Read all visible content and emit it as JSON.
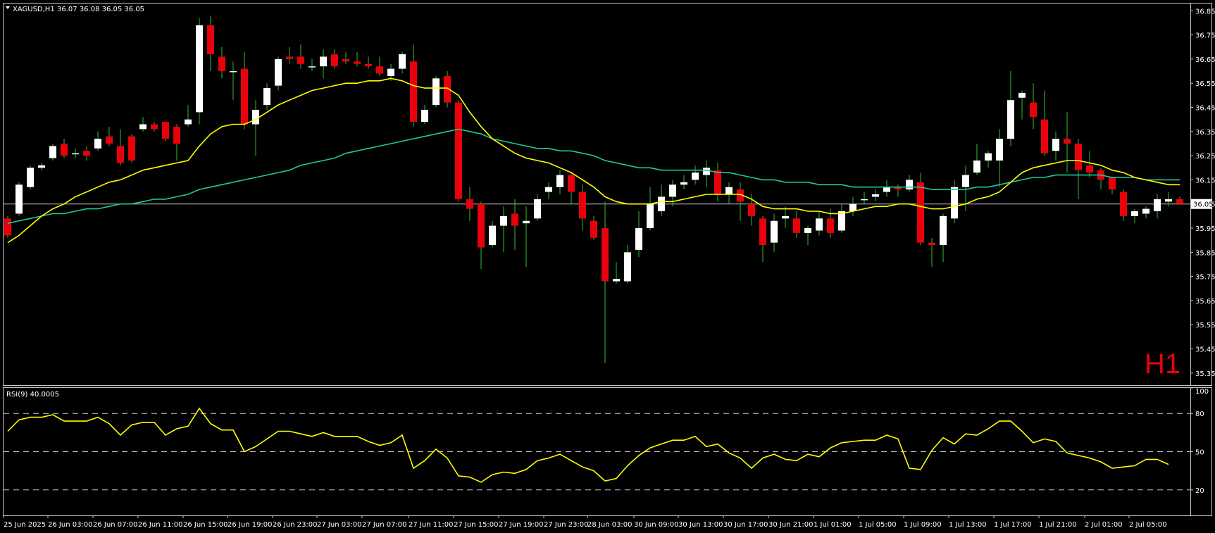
{
  "header": {
    "symbol": "XAGUSD,H1",
    "ohlc": "36.07 36.08 36.05 36.05",
    "timeframe_watermark": "H1"
  },
  "rsi_panel": {
    "label": "RSI(9) 40.0005"
  },
  "colors": {
    "background": "#000000",
    "frame": "#c8c8c8",
    "bull_candle": "#ffffff",
    "bear_candle": "#e8000b",
    "wick": "#2ec02e",
    "ma_fast": "#ffff00",
    "ma_slow": "#20c997",
    "rsi_line": "#ffff00",
    "price_line": "#c8c8c8",
    "watermark": "#e8000b"
  },
  "chart_data": [
    {
      "type": "candlestick",
      "title": "XAGUSD,H1",
      "ylim": [
        35.3,
        36.88
      ],
      "y_ticks": [
        "36.85",
        "36.75",
        "36.65",
        "36.55",
        "36.45",
        "36.35",
        "36.25",
        "36.15",
        "36.05",
        "35.95",
        "35.85",
        "35.75",
        "35.65",
        "35.55",
        "35.45",
        "35.35"
      ],
      "current_price": 36.05,
      "current_price_label": "36.05",
      "x_ticks": [
        "25 Jun 2025",
        "26 Jun 03:00",
        "26 Jun 07:00",
        "26 Jun 11:00",
        "26 Jun 15:00",
        "26 Jun 19:00",
        "26 Jun 23:00",
        "27 Jun 03:00",
        "27 Jun 07:00",
        "27 Jun 11:00",
        "27 Jun 15:00",
        "27 Jun 19:00",
        "27 Jun 23:00",
        "28 Jun 03:00",
        "30 Jun 09:00",
        "30 Jun 13:00",
        "30 Jun 17:00",
        "30 Jun 21:00",
        "1 Jul 01:00",
        "1 Jul 05:00",
        "1 Jul 09:00",
        "1 Jul 13:00",
        "1 Jul 17:00",
        "1 Jul 21:00",
        "2 Jul 01:00",
        "2 Jul 05:00"
      ],
      "candles": [
        [
          35.99,
          35.92,
          36.0,
          35.91
        ],
        [
          36.01,
          36.13,
          36.14,
          36.0
        ],
        [
          36.12,
          36.2,
          36.21,
          36.11
        ],
        [
          36.2,
          36.21,
          36.22,
          36.19
        ],
        [
          36.24,
          36.29,
          36.3,
          36.23
        ],
        [
          36.3,
          36.25,
          36.32,
          36.24
        ],
        [
          36.26,
          36.26,
          36.28,
          36.24
        ],
        [
          36.27,
          36.25,
          36.29,
          36.23
        ],
        [
          36.28,
          36.32,
          36.35,
          36.27
        ],
        [
          36.33,
          36.3,
          36.37,
          36.29
        ],
        [
          36.29,
          36.22,
          36.36,
          36.21
        ],
        [
          36.33,
          36.23,
          36.34,
          36.22
        ],
        [
          36.36,
          36.38,
          36.41,
          36.35
        ],
        [
          36.38,
          36.36,
          36.39,
          36.35
        ],
        [
          36.39,
          36.32,
          36.39,
          36.31
        ],
        [
          36.37,
          36.3,
          36.38,
          36.23
        ],
        [
          36.38,
          36.4,
          36.46,
          36.37
        ],
        [
          36.43,
          36.79,
          36.82,
          36.38
        ],
        [
          36.79,
          36.67,
          36.83,
          36.6
        ],
        [
          36.66,
          36.6,
          36.7,
          36.57
        ],
        [
          36.6,
          36.6,
          36.64,
          36.48
        ],
        [
          36.61,
          36.38,
          36.68,
          36.36
        ],
        [
          36.38,
          36.44,
          36.48,
          36.25
        ],
        [
          36.46,
          36.53,
          36.55,
          36.44
        ],
        [
          36.54,
          36.65,
          36.66,
          36.52
        ],
        [
          36.66,
          36.65,
          36.7,
          36.63
        ],
        [
          36.66,
          36.63,
          36.71,
          36.61
        ],
        [
          36.62,
          36.62,
          36.65,
          36.6
        ],
        [
          36.62,
          36.66,
          36.69,
          36.57
        ],
        [
          36.67,
          36.62,
          36.69,
          36.61
        ],
        [
          36.65,
          36.64,
          36.68,
          36.63
        ],
        [
          36.64,
          36.63,
          36.68,
          36.62
        ],
        [
          36.63,
          36.62,
          36.66,
          36.61
        ],
        [
          36.62,
          36.59,
          36.66,
          36.58
        ],
        [
          36.58,
          36.61,
          36.63,
          36.56
        ],
        [
          36.61,
          36.67,
          36.68,
          36.59
        ],
        [
          36.64,
          36.39,
          36.71,
          36.37
        ],
        [
          36.39,
          36.44,
          36.46,
          36.38
        ],
        [
          36.46,
          36.57,
          36.58,
          36.45
        ],
        [
          36.58,
          36.47,
          36.6,
          36.45
        ],
        [
          36.47,
          36.07,
          36.48,
          36.06
        ],
        [
          36.07,
          36.03,
          36.12,
          35.98
        ],
        [
          36.05,
          35.87,
          36.06,
          35.78
        ],
        [
          35.88,
          35.96,
          35.98,
          35.87
        ],
        [
          35.96,
          36.0,
          36.04,
          35.85
        ],
        [
          36.01,
          35.96,
          36.07,
          35.86
        ],
        [
          35.97,
          35.98,
          36.04,
          35.79
        ],
        [
          35.99,
          36.07,
          36.09,
          35.98
        ],
        [
          36.1,
          36.12,
          36.14,
          36.07
        ],
        [
          36.12,
          36.17,
          36.19,
          36.09
        ],
        [
          36.17,
          36.1,
          36.18,
          36.05
        ],
        [
          36.1,
          35.99,
          36.13,
          35.94
        ],
        [
          35.98,
          35.91,
          36.0,
          35.9
        ],
        [
          35.95,
          35.73,
          36.06,
          35.39
        ],
        [
          35.73,
          35.74,
          35.81,
          35.72
        ],
        [
          35.73,
          35.85,
          35.88,
          35.72
        ],
        [
          35.86,
          35.95,
          36.02,
          35.83
        ],
        [
          35.95,
          36.05,
          36.12,
          35.94
        ],
        [
          36.02,
          36.08,
          36.13,
          36.0
        ],
        [
          36.08,
          36.13,
          36.15,
          36.04
        ],
        [
          36.13,
          36.14,
          36.17,
          36.11
        ],
        [
          36.15,
          36.18,
          36.21,
          36.13
        ],
        [
          36.17,
          36.2,
          36.23,
          36.12
        ],
        [
          36.19,
          36.09,
          36.22,
          36.06
        ],
        [
          36.09,
          36.12,
          36.14,
          36.05
        ],
        [
          36.11,
          36.06,
          36.14,
          35.98
        ],
        [
          36.05,
          36.0,
          36.09,
          35.96
        ],
        [
          35.99,
          35.88,
          36.0,
          35.81
        ],
        [
          35.89,
          35.98,
          36.01,
          35.85
        ],
        [
          35.99,
          36.0,
          36.04,
          35.95
        ],
        [
          35.99,
          35.93,
          36.02,
          35.91
        ],
        [
          35.93,
          35.95,
          35.96,
          35.88
        ],
        [
          35.94,
          35.99,
          36.02,
          35.92
        ],
        [
          35.99,
          35.93,
          36.03,
          35.91
        ],
        [
          35.94,
          36.02,
          36.05,
          35.93
        ],
        [
          36.02,
          36.05,
          36.08,
          36.0
        ],
        [
          36.07,
          36.07,
          36.1,
          36.05
        ],
        [
          36.08,
          36.09,
          36.11,
          36.06
        ],
        [
          36.1,
          36.12,
          36.15,
          36.08
        ],
        [
          36.12,
          36.11,
          36.13,
          36.08
        ],
        [
          36.11,
          36.15,
          36.17,
          36.1
        ],
        [
          36.14,
          35.89,
          36.18,
          35.88
        ],
        [
          35.89,
          35.88,
          35.91,
          35.79
        ],
        [
          35.88,
          36.0,
          36.01,
          35.81
        ],
        [
          35.99,
          36.12,
          36.15,
          35.97
        ],
        [
          36.12,
          36.17,
          36.21,
          36.02
        ],
        [
          36.18,
          36.23,
          36.3,
          36.17
        ],
        [
          36.23,
          36.26,
          36.27,
          36.2
        ],
        [
          36.23,
          36.32,
          36.36,
          36.12
        ],
        [
          36.32,
          36.48,
          36.6,
          36.29
        ],
        [
          36.49,
          36.51,
          36.52,
          36.4
        ],
        [
          36.47,
          36.41,
          36.55,
          36.36
        ],
        [
          36.4,
          36.26,
          36.52,
          36.25
        ],
        [
          36.27,
          36.32,
          36.35,
          36.23
        ],
        [
          36.32,
          36.3,
          36.43,
          36.18
        ],
        [
          36.3,
          36.19,
          36.32,
          36.07
        ],
        [
          36.21,
          36.18,
          36.27,
          36.16
        ],
        [
          36.19,
          36.15,
          36.2,
          36.11
        ],
        [
          36.16,
          36.11,
          36.16,
          36.09
        ],
        [
          36.1,
          36.0,
          36.11,
          35.98
        ],
        [
          36.0,
          36.02,
          36.03,
          35.97
        ],
        [
          36.01,
          36.03,
          36.04,
          35.99
        ],
        [
          36.02,
          36.07,
          36.09,
          35.99
        ],
        [
          36.06,
          36.07,
          36.1,
          36.04
        ],
        [
          36.07,
          36.05,
          36.08,
          36.05
        ]
      ],
      "ma_fast": [
        35.89,
        35.92,
        35.96,
        36.0,
        36.03,
        36.05,
        36.08,
        36.1,
        36.12,
        36.14,
        36.15,
        36.17,
        36.19,
        36.2,
        36.21,
        36.22,
        36.23,
        36.29,
        36.34,
        36.37,
        36.38,
        36.38,
        36.4,
        36.43,
        36.46,
        36.48,
        36.5,
        36.52,
        36.53,
        36.54,
        36.55,
        36.55,
        36.56,
        36.56,
        36.57,
        36.56,
        36.54,
        36.53,
        36.53,
        36.53,
        36.5,
        36.43,
        36.37,
        36.32,
        36.29,
        36.26,
        36.24,
        36.23,
        36.22,
        36.2,
        36.18,
        36.15,
        36.12,
        36.08,
        36.06,
        36.05,
        36.05,
        36.05,
        36.06,
        36.06,
        36.07,
        36.08,
        36.09,
        36.09,
        36.09,
        36.09,
        36.07,
        36.04,
        36.03,
        36.03,
        36.03,
        36.02,
        36.02,
        36.01,
        36.01,
        36.02,
        36.03,
        36.04,
        36.04,
        36.05,
        36.05,
        36.04,
        36.03,
        36.03,
        36.04,
        36.05,
        36.07,
        36.08,
        36.1,
        36.14,
        36.18,
        36.2,
        36.21,
        36.22,
        36.23,
        36.23,
        36.22,
        36.21,
        36.19,
        36.18,
        36.16,
        36.15,
        36.14,
        36.13,
        36.13
      ],
      "ma_slow": [
        35.97,
        35.98,
        35.99,
        36.0,
        36.01,
        36.01,
        36.02,
        36.03,
        36.03,
        36.04,
        36.05,
        36.05,
        36.06,
        36.07,
        36.07,
        36.08,
        36.09,
        36.11,
        36.12,
        36.13,
        36.14,
        36.15,
        36.16,
        36.17,
        36.18,
        36.19,
        36.21,
        36.22,
        36.23,
        36.24,
        36.26,
        36.27,
        36.28,
        36.29,
        36.3,
        36.31,
        36.32,
        36.33,
        36.34,
        36.35,
        36.36,
        36.35,
        36.34,
        36.32,
        36.31,
        36.3,
        36.29,
        36.28,
        36.28,
        36.27,
        36.27,
        36.26,
        36.25,
        36.23,
        36.22,
        36.21,
        36.2,
        36.2,
        36.19,
        36.19,
        36.19,
        36.19,
        36.19,
        36.18,
        36.18,
        36.17,
        36.16,
        36.15,
        36.15,
        36.14,
        36.14,
        36.14,
        36.13,
        36.13,
        36.13,
        36.12,
        36.12,
        36.12,
        36.12,
        36.12,
        36.12,
        36.12,
        36.11,
        36.11,
        36.11,
        36.11,
        36.12,
        36.12,
        36.13,
        36.14,
        36.15,
        36.16,
        36.16,
        36.17,
        36.17,
        36.17,
        36.17,
        36.17,
        36.16,
        36.16,
        36.16,
        36.15,
        36.15,
        36.15,
        36.15
      ]
    },
    {
      "type": "line",
      "title": "RSI(9) 40.0005",
      "ylim": [
        0,
        100
      ],
      "y_ticks": [
        "100",
        "80",
        "50",
        "20"
      ],
      "levels": [
        20,
        50,
        80
      ],
      "values": [
        66,
        75,
        77,
        77,
        79,
        74,
        74,
        74,
        77,
        72,
        63,
        71,
        73,
        73,
        63,
        68,
        70,
        84,
        72,
        67,
        67,
        50,
        54,
        60,
        66,
        66,
        64,
        62,
        65,
        62,
        62,
        62,
        58,
        55,
        57,
        63,
        37,
        43,
        52,
        45,
        31,
        30,
        26,
        32,
        34,
        33,
        36,
        43,
        45,
        48,
        43,
        38,
        35,
        27,
        29,
        39,
        47,
        53,
        56,
        59,
        59,
        62,
        54,
        56,
        49,
        45,
        37,
        45,
        48,
        44,
        43,
        48,
        46,
        53,
        57,
        58,
        59,
        59,
        63,
        60,
        37,
        36,
        51,
        61,
        56,
        64,
        63,
        68,
        74,
        74,
        66,
        57,
        60,
        58,
        49,
        47,
        45,
        42,
        37,
        38,
        39,
        44,
        44,
        40
      ]
    }
  ]
}
